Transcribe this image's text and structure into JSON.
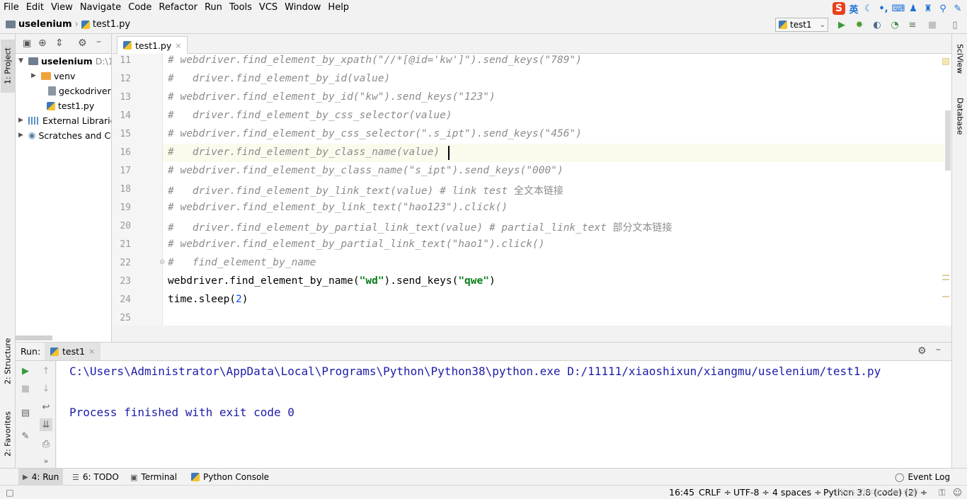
{
  "menu": [
    "File",
    "Edit",
    "View",
    "Navigate",
    "Code",
    "Refactor",
    "Run",
    "Tools",
    "VCS",
    "Window",
    "Help"
  ],
  "ime": {
    "logo": "S",
    "lang": "英"
  },
  "breadcrumb": {
    "project": "uselenium",
    "file": "test1.py"
  },
  "run_config": "test1",
  "left_tabs": {
    "project": "1: Project",
    "structure": "2: Structure",
    "favorites": "2: Favorites"
  },
  "right_tabs": {
    "sciview": "SciView",
    "database": "Database"
  },
  "project_tree": {
    "root": "uselenium",
    "root_path": "D:\\1",
    "items": [
      "venv",
      "geckodriver.l",
      "test1.py"
    ],
    "external": "External Librarie",
    "scratches": "Scratches and Co"
  },
  "editor": {
    "tab": "test1.py",
    "close": "×",
    "lines": [
      {
        "n": "11",
        "parts": [
          [
            "cm",
            "# webdriver.find_element_by_xpath(\"//*[@id='kw']\").send_keys(\"789\")"
          ]
        ]
      },
      {
        "n": "12",
        "parts": [
          [
            "cm",
            "#   driver.find_element_by_id(value)"
          ]
        ]
      },
      {
        "n": "13",
        "parts": [
          [
            "cm",
            "# webdriver.find_element_by_id(\"kw\").send_keys(\"123\")"
          ]
        ]
      },
      {
        "n": "14",
        "parts": [
          [
            "cm",
            "#   driver.find_element_by_css_selector(value)"
          ]
        ]
      },
      {
        "n": "15",
        "parts": [
          [
            "cm",
            "# webdriver.find_element_by_css_selector(\".s_ipt\").send_keys(\"456\")"
          ]
        ]
      },
      {
        "n": "16",
        "parts": [
          [
            "cm",
            "#   driver.find_element_by_class_name(value)"
          ]
        ]
      },
      {
        "n": "17",
        "parts": [
          [
            "cm",
            "# webdriver.find_element_by_class_name(\"s_ipt\").send_keys(\"000\")"
          ]
        ]
      },
      {
        "n": "18",
        "parts": [
          [
            "cm",
            "#   driver.find_element_by_link_text(value) # link test "
          ],
          [
            "cmcn",
            "全文本链接"
          ]
        ]
      },
      {
        "n": "19",
        "parts": [
          [
            "cm",
            "# webdriver.find_element_by_link_text(\"hao123\").click()"
          ]
        ]
      },
      {
        "n": "20",
        "parts": [
          [
            "cm",
            "#   driver.find_element_by_partial_link_text(value) # partial_link_text "
          ],
          [
            "cmcn",
            "部分文本链接"
          ]
        ]
      },
      {
        "n": "21",
        "parts": [
          [
            "cm",
            "# webdriver.find_element_by_partial_link_text(\"hao1\").click()"
          ]
        ]
      },
      {
        "n": "22",
        "parts": [
          [
            "cm",
            "#   find_element_by_name"
          ]
        ]
      },
      {
        "n": "23",
        "parts": [
          [
            "tx",
            "webdriver.find_element_by_name("
          ],
          [
            "str",
            "\"wd\""
          ],
          [
            "tx",
            ").send_keys("
          ],
          [
            "str",
            "\"qwe\""
          ],
          [
            "tx",
            ")"
          ]
        ]
      },
      {
        "n": "24",
        "parts": [
          [
            "tx",
            "time.sleep("
          ],
          [
            "num",
            "2"
          ],
          [
            "tx",
            ")"
          ]
        ]
      },
      {
        "n": "25",
        "parts": []
      }
    ]
  },
  "run_panel": {
    "title": "Run:",
    "tab": "test1",
    "output": [
      "C:\\Users\\Administrator\\AppData\\Local\\Programs\\Python\\Python38\\python.exe D:/11111/xiaoshixun/xiangmu/uselenium/test1.py",
      "",
      "Process finished with exit code 0"
    ]
  },
  "bottom_tabs": {
    "run": "4: Run",
    "todo": "6: TODO",
    "terminal": "Terminal",
    "python_console": "Python Console",
    "event_log": "Event Log"
  },
  "status": {
    "position": "16:45",
    "line_sep": "CRLF ÷",
    "encoding": "UTF-8 ÷",
    "indent": "4 spaces ÷",
    "interpreter": "Python 3.8 (code) (2) ÷"
  },
  "watermark": "https://blog.csdn.net/..."
}
